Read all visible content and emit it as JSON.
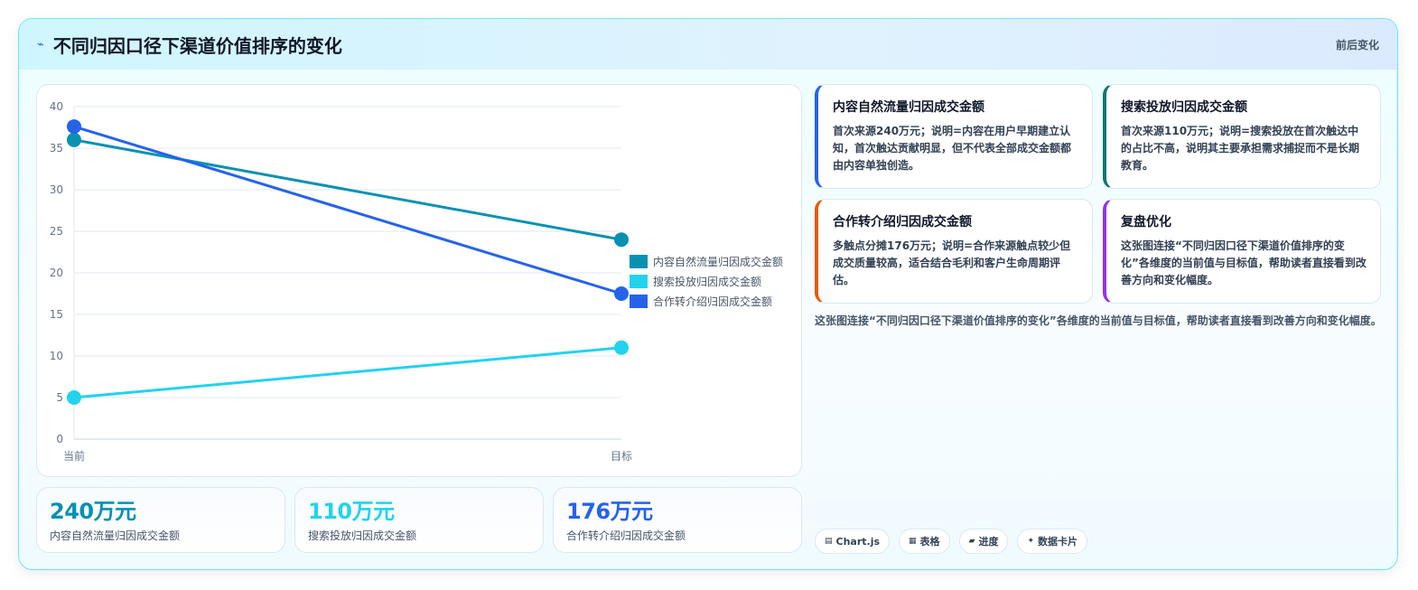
{
  "header": {
    "icon": "lightning-icon",
    "title": "不同归因口径下渠道价值排序的变化",
    "tag": "前后变化"
  },
  "chart_data": {
    "type": "line",
    "categories": [
      "当前",
      "目标"
    ],
    "ylim": [
      0,
      40
    ],
    "yticks": [
      0,
      5,
      10,
      15,
      20,
      25,
      30,
      35,
      40
    ],
    "grid": true,
    "legend": "right",
    "series": [
      {
        "name": "内容自然流量归因成交金额",
        "values": [
          36,
          24
        ],
        "color": "#0891b2"
      },
      {
        "name": "搜索投放归因成交金额",
        "values": [
          5,
          11
        ],
        "color": "#22d3ee"
      },
      {
        "name": "合作转介绍归因成交金额",
        "values": [
          37.6,
          17.5
        ],
        "color": "#2563eb"
      }
    ]
  },
  "kpis": [
    {
      "value": "240万元",
      "label": "内容自然流量归因成交金额",
      "color": "#0891b2"
    },
    {
      "value": "110万元",
      "label": "搜索投放归因成交金额",
      "color": "#22d3ee"
    },
    {
      "value": "176万元",
      "label": "合作转介绍归因成交金额",
      "color": "#2563eb"
    }
  ],
  "insights": [
    {
      "title": "内容自然流量归因成交金额",
      "text": "首次来源240万元；说明=内容在用户早期建立认知，首次触达贡献明显，但不代表全部成交金额都由内容单独创造。",
      "color": "#2563eb"
    },
    {
      "title": "搜索投放归因成交金额",
      "text": "首次来源110万元；说明=搜索投放在首次触达中的占比不高，说明其主要承担需求捕捉而不是长期教育。",
      "color": "#0f766e"
    },
    {
      "title": "合作转介绍归因成交金额",
      "text": "多触点分摊176万元；说明=合作来源触点较少但成交质量较高，适合结合毛利和客户生命周期评估。",
      "color": "#ea580c"
    },
    {
      "title": "复盘优化",
      "text": "这张图连接“不同归因口径下渠道价值排序的变化”各维度的当前值与目标值，帮助读者直接看到改善方向和变化幅度。",
      "color": "#9333ea"
    }
  ],
  "summary": "这张图连接“不同归因口径下渠道价值排序的变化”各维度的当前值与目标值，帮助读者直接看到改善方向和变化幅度。",
  "chips": [
    {
      "icon": "chart-icon",
      "glyph": "▤",
      "label": "Chart.js"
    },
    {
      "icon": "table-icon",
      "glyph": "▦",
      "label": "表格"
    },
    {
      "icon": "progress-icon",
      "glyph": "▰",
      "label": "进度"
    },
    {
      "icon": "sparkle-icon",
      "glyph": "✦",
      "label": "数据卡片"
    }
  ]
}
